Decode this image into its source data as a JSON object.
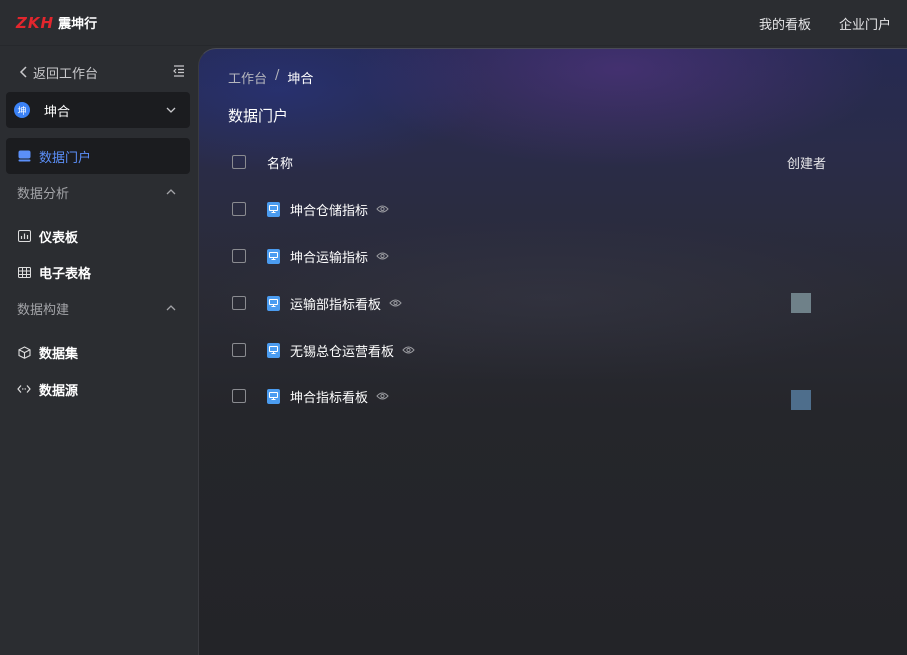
{
  "brand": {
    "logo_latin": "ZKH",
    "logo_cn": "震坤行",
    "accent": "#e3262d"
  },
  "topnav": {
    "my_board": "我的看板",
    "enterprise_portal": "企业门户"
  },
  "sidebar": {
    "back_label": "返回工作台",
    "portal": {
      "avatar_text": "坤",
      "name": "坤合"
    },
    "items": [
      {
        "label": "数据门户",
        "icon": "portal-icon",
        "active": true
      },
      {
        "label": "仪表板",
        "icon": "dashboard-icon"
      },
      {
        "label": "电子表格",
        "icon": "table-icon"
      },
      {
        "label": "数据集",
        "icon": "cube-icon"
      },
      {
        "label": "数据源",
        "icon": "code-icon"
      }
    ],
    "sections": {
      "analysis": "数据分析",
      "build": "数据构建"
    },
    "active_color": "#5b8ff9"
  },
  "breadcrumb": {
    "root": "工作台",
    "separator": "/",
    "current": "坤合"
  },
  "page_title": "数据门户",
  "table": {
    "headers": {
      "name": "名称",
      "creator": "创建者"
    },
    "rows": [
      {
        "name": "坤合仓储指标",
        "creator_color": ""
      },
      {
        "name": "坤合运输指标",
        "creator_color": ""
      },
      {
        "name": "运输部指标看板",
        "creator_color": "#6f8189"
      },
      {
        "name": "无锡总仓运营看板",
        "creator_color": ""
      },
      {
        "name": "坤合指标看板",
        "creator_color": "#4e6e8c"
      }
    ]
  }
}
